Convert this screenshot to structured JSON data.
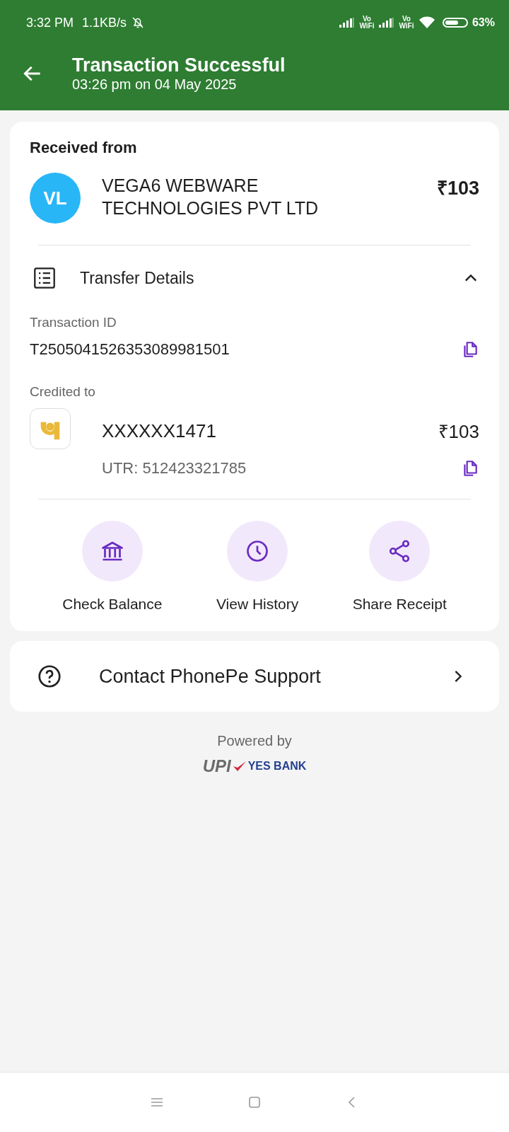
{
  "status_bar": {
    "time": "3:32 PM",
    "speed": "1.1KB/s",
    "sim_labels": [
      "Vo WiFi",
      "Vo WiFi"
    ],
    "battery": "63%"
  },
  "header": {
    "title": "Transaction Successful",
    "subtitle": "03:26 pm on 04 May 2025"
  },
  "payment": {
    "heading": "Received from",
    "avatar": "VL",
    "sender": "VEGA6 WEBWARE TECHNOLOGIES PVT LTD",
    "amount": "₹103"
  },
  "details": {
    "title": "Transfer Details",
    "expanded": true,
    "transaction_id_label": "Transaction ID",
    "transaction_id": "T2505041526353089981501",
    "credited_label": "Credited to",
    "account": "XXXXXX1471",
    "account_amount": "₹103",
    "utr": "UTR: 512423321785"
  },
  "actions": [
    {
      "kind": "bank",
      "label": "Check Balance"
    },
    {
      "kind": "history",
      "label": "View History"
    },
    {
      "kind": "share",
      "label": "Share Receipt"
    }
  ],
  "support": {
    "label": "Contact PhonePe Support"
  },
  "footer": {
    "powered_by": "Powered by",
    "upi": "UPI",
    "bank": "YES BANK"
  }
}
